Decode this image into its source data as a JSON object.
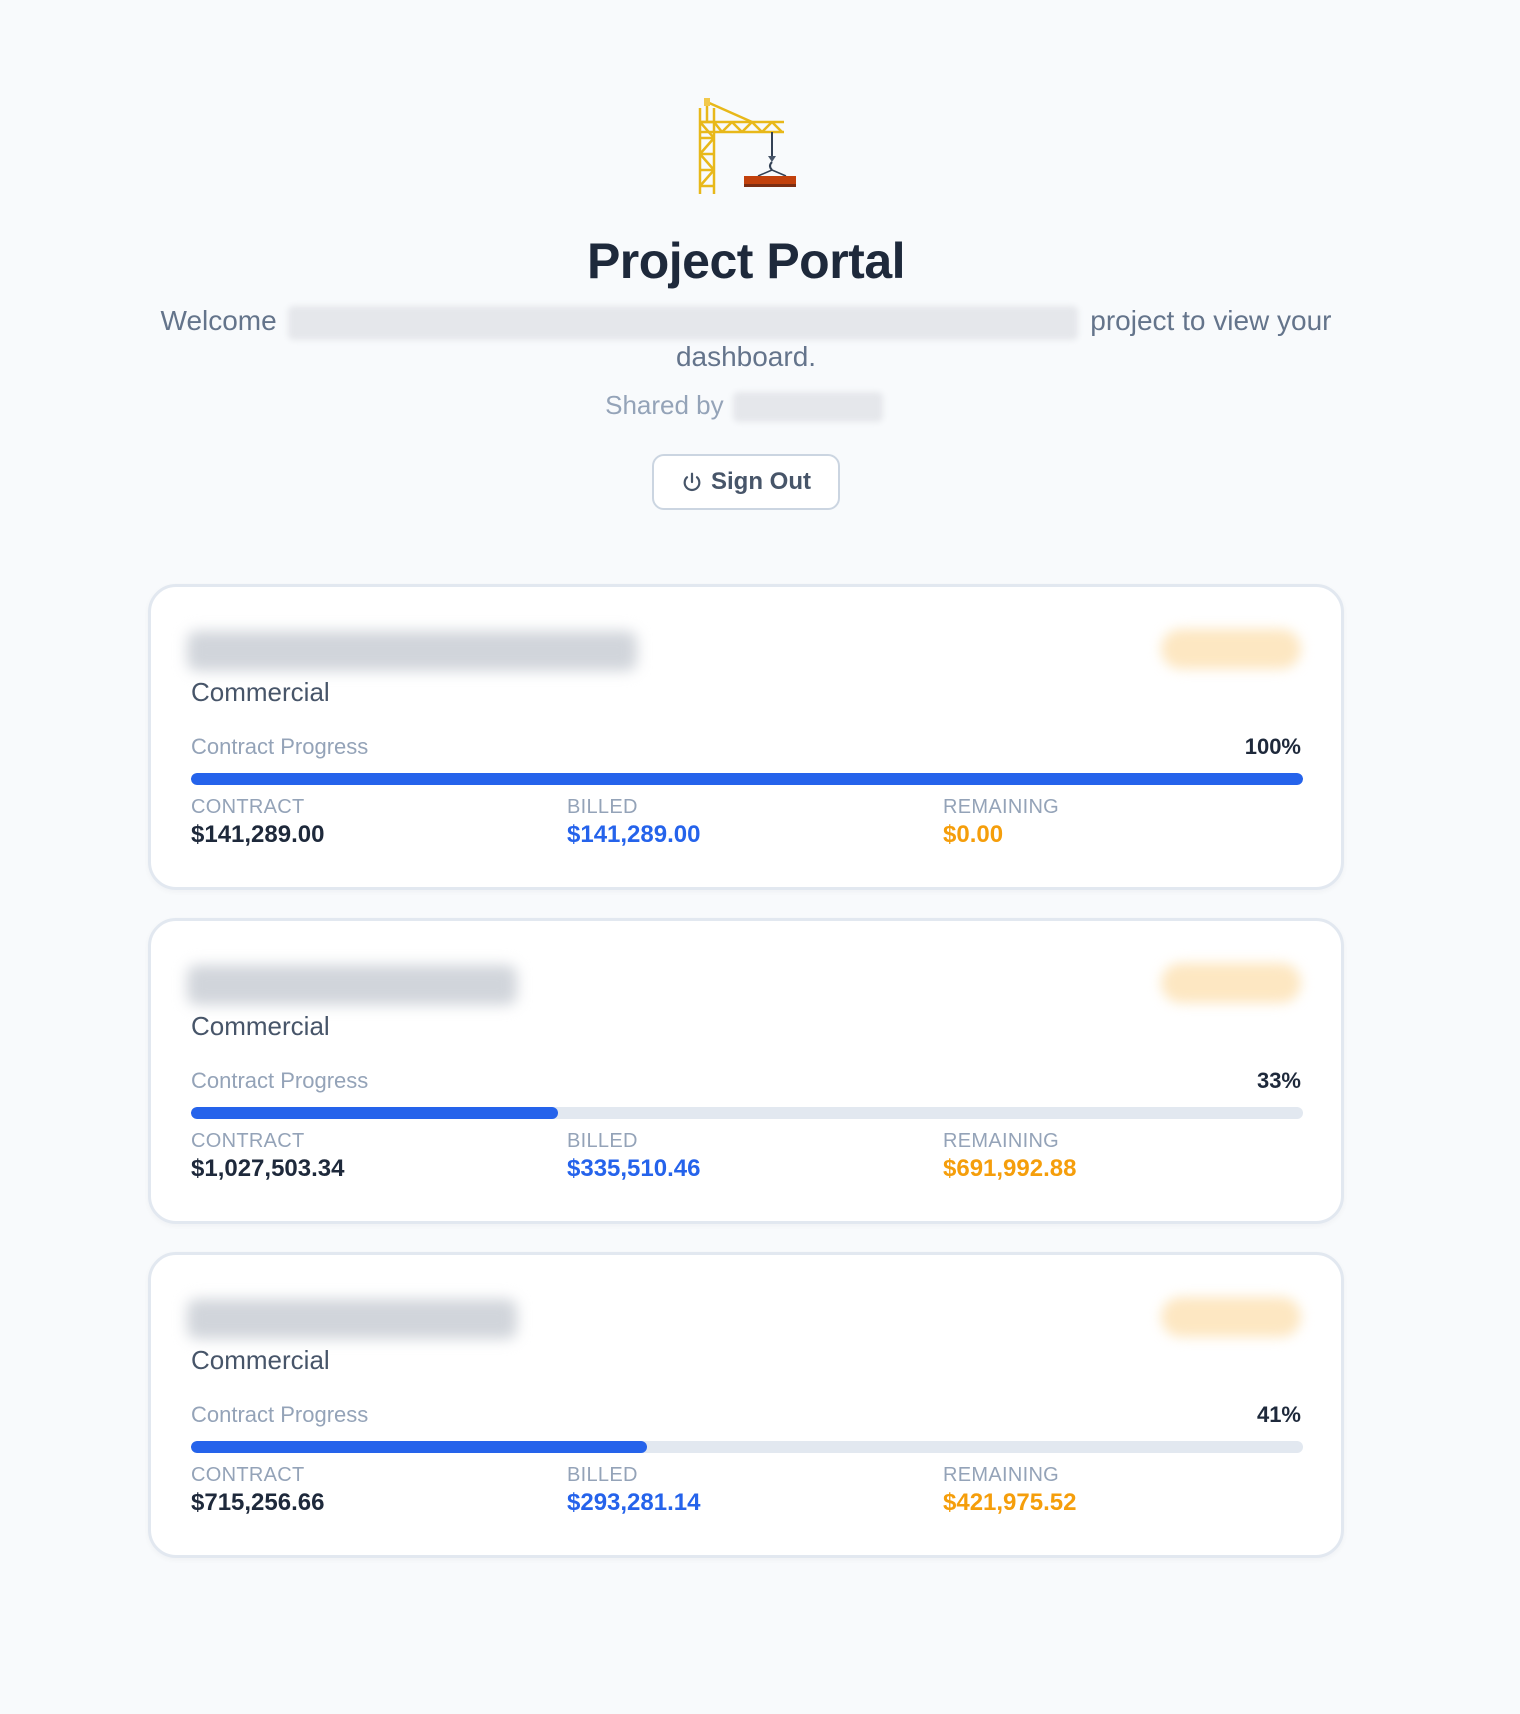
{
  "header": {
    "logo_icon": "construction-crane-icon",
    "title": "Project Portal",
    "welcome_prefix": "Welcome",
    "welcome_suffix": "project to view your dashboard.",
    "shared_prefix": "Shared by",
    "signout_label": "Sign Out",
    "signout_icon": "power-icon"
  },
  "colors": {
    "accent": "#2563eb",
    "remaining": "#f59e0b",
    "background": "#f8fafc"
  },
  "projects": [
    {
      "type": "Commercial",
      "progress_label": "Contract Progress",
      "progress_pct": "100%",
      "progress_fraction": 1.0,
      "contract_label": "CONTRACT",
      "contract_value": "$141,289.00",
      "billed_label": "BILLED",
      "billed_value": "$141,289.00",
      "remaining_label": "REMAINING",
      "remaining_value": "$0.00"
    },
    {
      "type": "Commercial",
      "progress_label": "Contract Progress",
      "progress_pct": "33%",
      "progress_fraction": 0.33,
      "contract_label": "CONTRACT",
      "contract_value": "$1,027,503.34",
      "billed_label": "BILLED",
      "billed_value": "$335,510.46",
      "remaining_label": "REMAINING",
      "remaining_value": "$691,992.88"
    },
    {
      "type": "Commercial",
      "progress_label": "Contract Progress",
      "progress_pct": "41%",
      "progress_fraction": 0.41,
      "contract_label": "CONTRACT",
      "contract_value": "$715,256.66",
      "billed_label": "BILLED",
      "billed_value": "$293,281.14",
      "remaining_label": "REMAINING",
      "remaining_value": "$421,975.52"
    }
  ]
}
